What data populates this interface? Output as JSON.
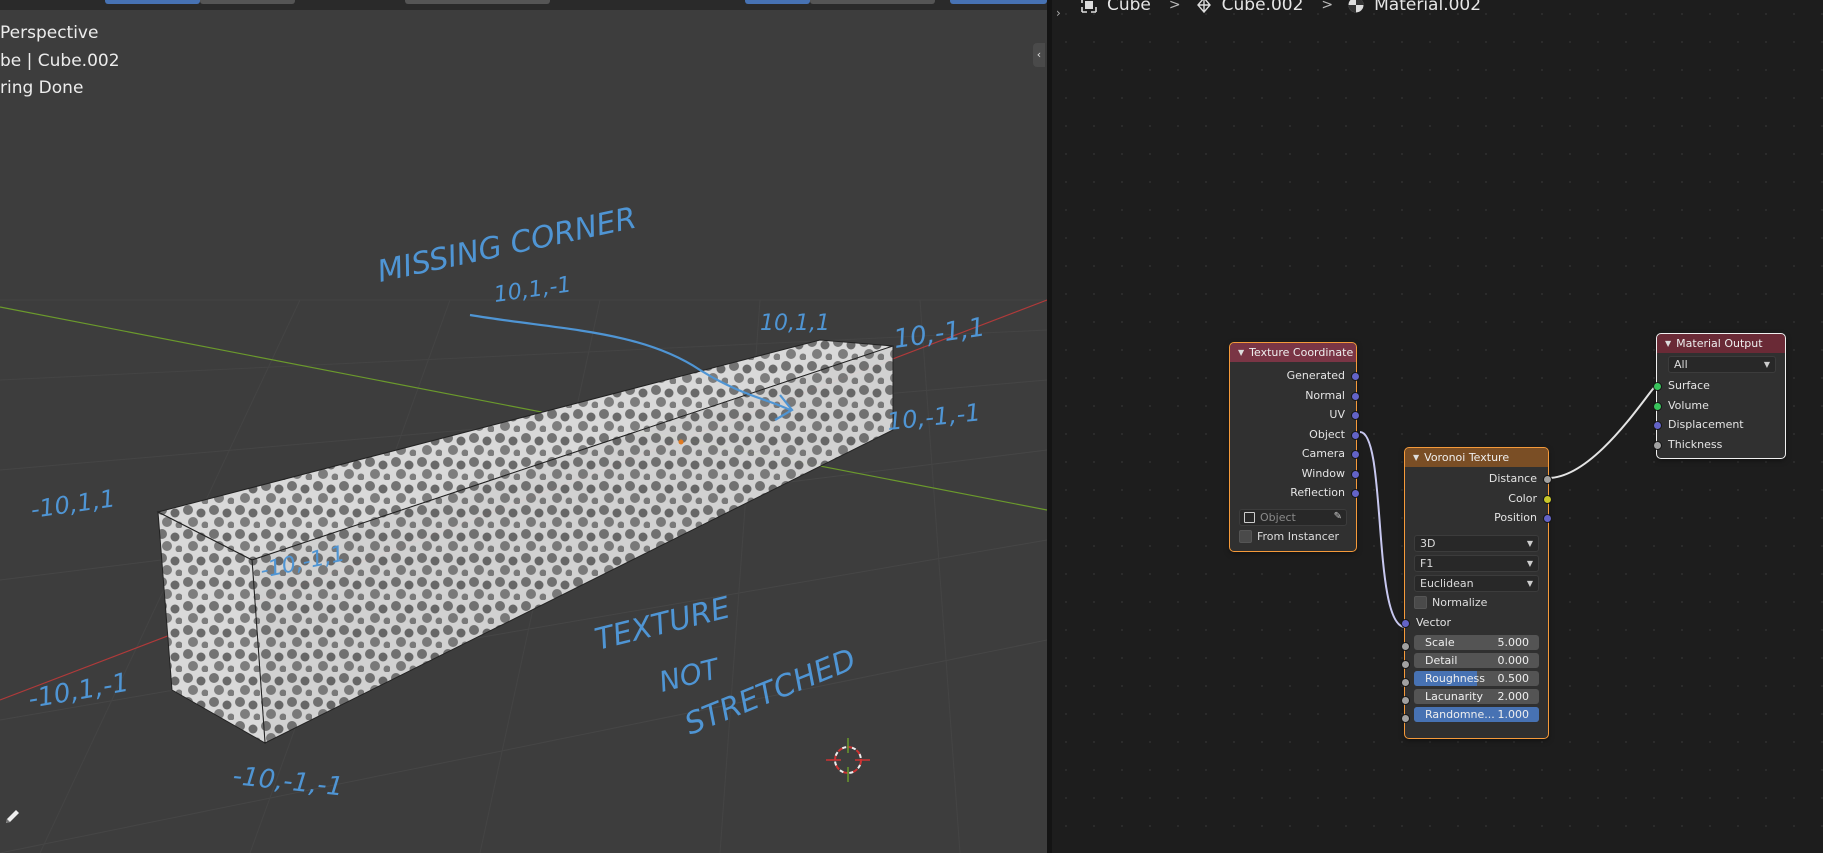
{
  "viewport": {
    "overlay_lines": [
      "Perspective",
      "be | Cube.002",
      "ring Done"
    ],
    "annotations": {
      "missing_corner": "MISSING CORNER",
      "missing_corner_coord": "10,1,-1",
      "top_right_back": "10,1,1",
      "top_right_front": "10,-1,1",
      "bottom_right_front": "10,-1,-1",
      "left_back_top": "-10,1,1",
      "left_front_top": "-10,-1,1",
      "left_back_bottom": "-10,1,-1",
      "left_front_bottom": "-10,-1,-1",
      "texture_line1": "TEXTURE",
      "texture_line2": "NOT",
      "texture_line3": "STRETCHED"
    },
    "colors": {
      "background": "#3d3d3d",
      "annotation": "#4f95d4",
      "x_axis": "#b03a3a",
      "y_axis": "#6b9a2c"
    }
  },
  "breadcrumb": {
    "items": [
      "Cube",
      "Cube.002",
      "Material.002"
    ]
  },
  "nodes": {
    "texture_coordinate": {
      "title": "Texture Coordinate",
      "outputs": [
        "Generated",
        "Normal",
        "UV",
        "Object",
        "Camera",
        "Window",
        "Reflection"
      ],
      "object_placeholder": "Object",
      "from_instancer": "From Instancer"
    },
    "voronoi": {
      "title": "Voronoi Texture",
      "outputs": [
        "Distance",
        "Color",
        "Position"
      ],
      "dimensions": "3D",
      "feature": "F1",
      "metric": "Euclidean",
      "normalize": "Normalize",
      "vector": "Vector",
      "params": [
        {
          "label": "Scale",
          "value": "5.000",
          "fill": 0
        },
        {
          "label": "Detail",
          "value": "0.000",
          "fill": 0
        },
        {
          "label": "Roughness",
          "value": "0.500",
          "fill": 0.5
        },
        {
          "label": "Lacunarity",
          "value": "2.000",
          "fill": 0
        },
        {
          "label": "Randomne...",
          "value": "1.000",
          "fill": 1
        }
      ]
    },
    "material_output": {
      "title": "Material Output",
      "target": "All",
      "inputs": [
        "Surface",
        "Volume",
        "Displacement",
        "Thickness"
      ]
    }
  }
}
